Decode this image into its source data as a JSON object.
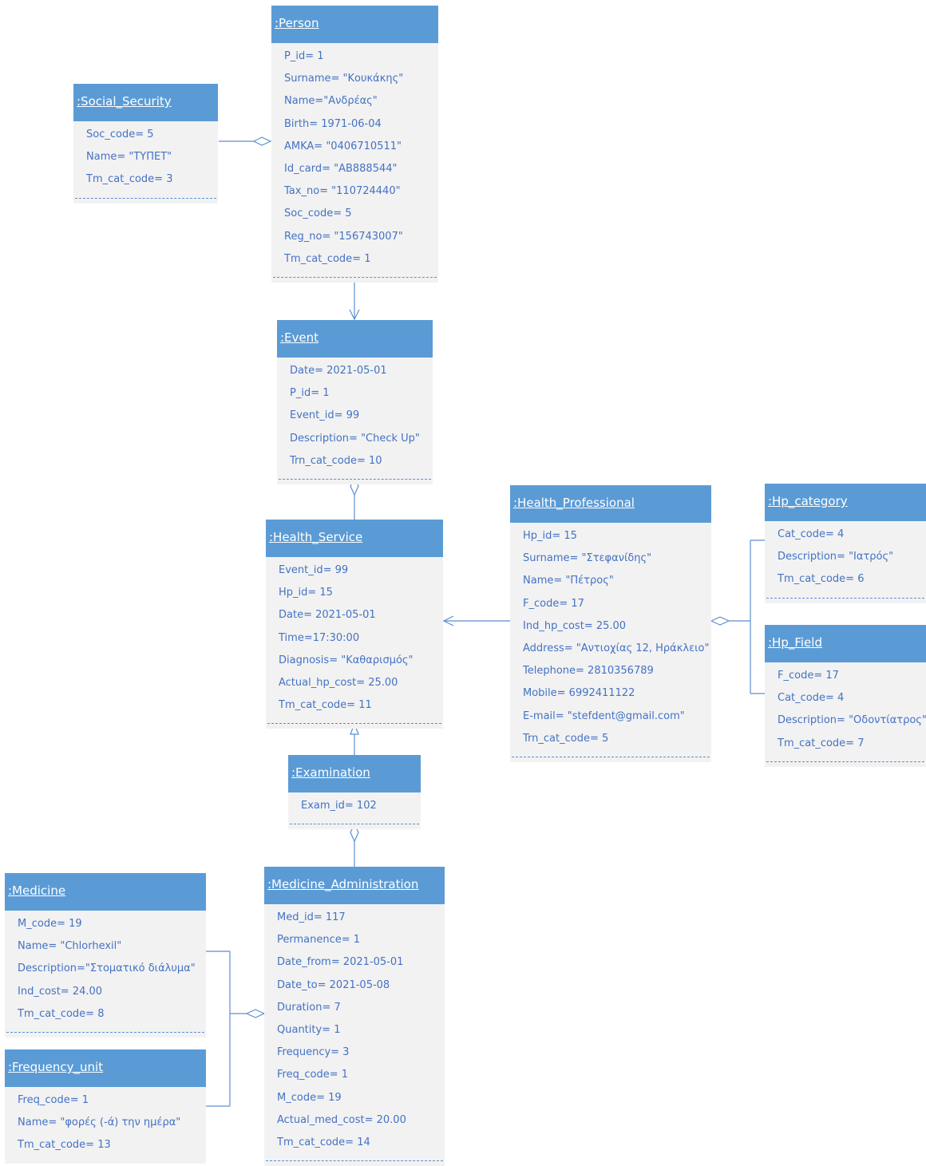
{
  "objects": {
    "person": {
      "title": ":Person",
      "attrs": [
        "P_id= 1",
        "Surname= \"Κουκάκης\"",
        "Name=\"Ανδρέας\"",
        "Birth= 1971-06-04",
        "AMKA= \"0406710511\"",
        "Id_card= \"AB888544\"",
        "Tax_no= \"110724440\"",
        "Soc_code= 5",
        "Reg_no= \"156743007\"",
        "Tm_cat_code= 1"
      ]
    },
    "social_security": {
      "title": ":Social_Security",
      "attrs": [
        "Soc_code= 5",
        "Name= \"ΤΥΠΕΤ\"",
        "Tm_cat_code= 3"
      ]
    },
    "event": {
      "title": ":Event",
      "attrs": [
        "Date= 2021-05-01",
        "P_id= 1",
        "Event_id= 99",
        "Description= \"Check Up\"",
        "Trn_cat_code= 10"
      ]
    },
    "health_service": {
      "title": ":Health_Service",
      "attrs": [
        "Event_id= 99",
        "Hp_id= 15",
        "Date= 2021-05-01",
        "Time=17:30:00",
        "Diagnosis= \"Καθαρισμός\"",
        "Actual_hp_cost= 25.00",
        "Tm_cat_code= 11"
      ]
    },
    "health_professional": {
      "title": ":Health_Professional",
      "attrs": [
        "Hp_id= 15",
        "Surname= \"Στεφανίδης\"",
        "Name= \"Πέτρος\"",
        "F_code= 17",
        "Ind_hp_cost= 25.00",
        "Address= \"Αντιοχίας 12, Ηράκλειο\"",
        "Telephone= 2810356789",
        "Mobile= 6992411122",
        "E-mail= \"stefdent@gmail.com\"",
        "Trn_cat_code= 5"
      ]
    },
    "hp_category": {
      "title": ":Hp_category",
      "attrs": [
        "Cat_code= 4",
        "Description= \"Ιατρός\"",
        "Tm_cat_code= 6"
      ]
    },
    "hp_field": {
      "title": ":Hp_Field",
      "attrs": [
        "F_code= 17",
        "Cat_code= 4",
        "Description= \"Οδοντίατρος\"",
        "Tm_cat_code= 7"
      ]
    },
    "examination": {
      "title": ":Examination",
      "attrs": [
        "Exam_id= 102"
      ]
    },
    "medicine_administration": {
      "title": ":Medicine_Administration",
      "attrs": [
        "Med_id= 117",
        "Permanence= 1",
        "Date_from= 2021-05-01",
        "Date_to= 2021-05-08",
        "Duration= 7",
        "Quantity= 1",
        "Frequency= 3",
        "Freq_code= 1",
        "M_code= 19",
        "Actual_med_cost= 20.00",
        "Tm_cat_code= 14"
      ]
    },
    "medicine": {
      "title": ":Medicine",
      "attrs": [
        "M_code= 19",
        "Name= \"Chlorhexil\"",
        "Description=\"Στοματικό διάλυμα\"",
        "Ind_cost= 24.00",
        "Tm_cat_code= 8"
      ]
    },
    "frequency_unit": {
      "title": ":Frequency_unit",
      "attrs": [
        "Freq_code= 1",
        "Name= \"φορές (-ά) την ημέρα\"",
        "Tm_cat_code= 13"
      ]
    }
  },
  "colors": {
    "header": "#5b9bd5",
    "body": "#f2f2f2",
    "text": "#4472c4",
    "line": "#5b8fd0"
  }
}
